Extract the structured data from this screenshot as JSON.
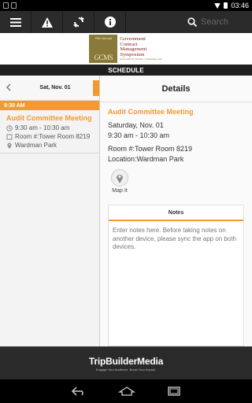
{
  "status_bar": {
    "time": "03:46"
  },
  "toolbar": {
    "buttons": [
      "menu-icon",
      "alert-icon",
      "refresh-icon",
      "info-icon"
    ],
    "search_placeholder": "Search"
  },
  "banner": {
    "logo_small_text": "Fifth Annual",
    "logo_mark": "GCMS",
    "logo_lines": [
      "Government",
      "Contract",
      "Management",
      "Symposium"
    ],
    "logo_sub": "Presented by NCMA / Washington DC"
  },
  "schedule": {
    "title": "SCHEDULE"
  },
  "date_nav": {
    "date": "Sat, Nov. 01"
  },
  "sessions": [
    {
      "time_header": "9:30 AM",
      "title": "Audit Committee Meeting",
      "time": "9:30 am - 10:30 am",
      "room": "Room #:Tower Room 8219",
      "location": "Wardman Park"
    }
  ],
  "details": {
    "header": "Details",
    "title": "Audit Committee Meeting",
    "date": "Saturday, Nov. 01",
    "time": "9:30 am - 10:30 am",
    "room": "Room #:Tower Room 8219",
    "location": "Location:Wardman Park",
    "map_label": "Map It"
  },
  "notes": {
    "header": "Notes",
    "placeholder": "Enter notes here. Before taking notes on another device, please sync the app on both devices."
  },
  "footer": {
    "brand": "TripBuilderMedia",
    "tagline": "Engage Your Audience. Boost Your Impact."
  },
  "colors": {
    "accent": "#f29a2e",
    "toolbar": "#2b2b2b"
  }
}
